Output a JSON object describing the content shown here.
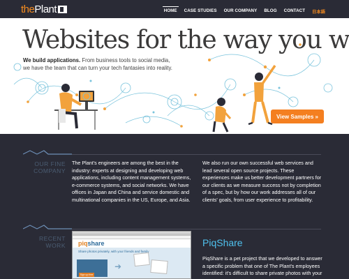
{
  "header": {
    "logo_the": "the",
    "logo_plant": "Plant",
    "nav": [
      {
        "label": "HOME",
        "active": true
      },
      {
        "label": "CASE STUDIES",
        "active": false
      },
      {
        "label": "OUR COMPANY",
        "active": false
      },
      {
        "label": "BLOG",
        "active": false
      },
      {
        "label": "CONTACT",
        "active": false
      },
      {
        "label": "日本語",
        "active": false
      }
    ]
  },
  "hero": {
    "title": "Websites for the way you work.",
    "sub_bold": "We build applications.",
    "sub_rest_1": " From business tools to social media,",
    "sub_line_2": "we have the team that can turn your tech fantasies into reality.",
    "cta": "View Samples »"
  },
  "company": {
    "label_1": "OUR FINE",
    "label_2": "COMPANY",
    "col1": "The Plant's engineers are among the best in the industry: experts at designing and developing web applications, including content management systems, e-commerce systems, and social networks. We have offices in Japan and China and service domestic and multinational companies in the US, Europe, and Asia.",
    "col2": "We also run our own successful web services and lead several open source projects. These experiences make us better development partners for our clients as we measure success not by completion of a spec, but by how our work addresses all of our clients' goals, from user experience to profitability."
  },
  "work": {
    "label_1": "RECENT",
    "label_2": "WORK",
    "shot_logo_a": "piq",
    "shot_logo_b": "share",
    "shot_tag": "Share photos privately, with your friends and family",
    "shot_btn": "Sign up free",
    "title": "PiqShare",
    "desc": "PiqShare is a pet project that we developed to answer a specific problem that one of The Plant's employees identified: it's difficult to share private photos with your"
  },
  "colors": {
    "accent": "#f58b1f",
    "background": "#2a2b36",
    "link_blue": "#4fc1ee",
    "label_blue": "#4b5d73"
  }
}
